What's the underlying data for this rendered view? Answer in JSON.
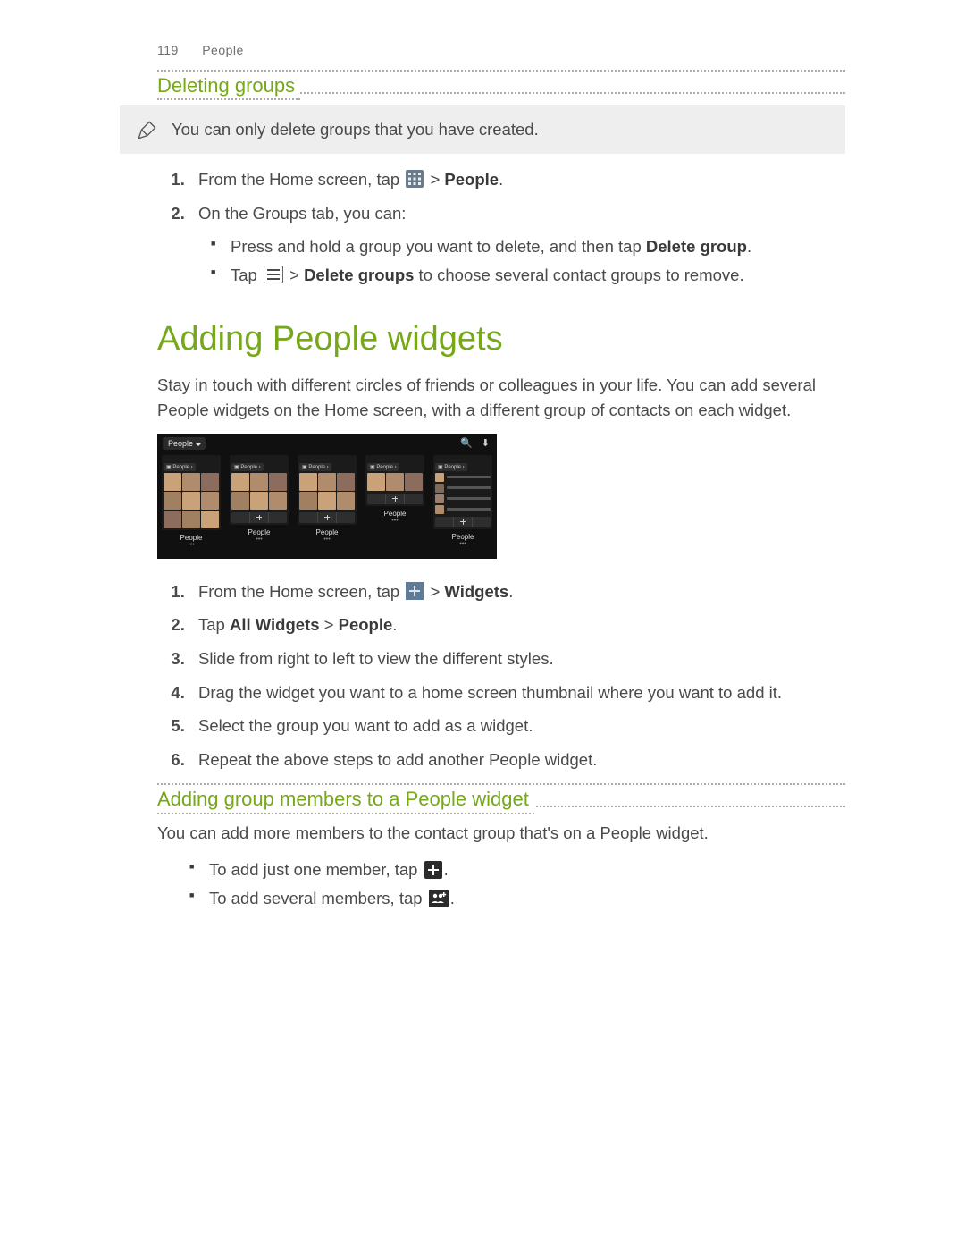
{
  "header": {
    "page_number": "119",
    "section": "People"
  },
  "deleting_groups": {
    "title": "Deleting groups",
    "note": "You can only delete groups that you have created.",
    "step1_a": "From the Home screen, tap ",
    "step1_b": " > ",
    "step1_people": "People",
    "step1_c": ".",
    "step2": "On the Groups tab, you can:",
    "bullet1_a": "Press and hold a group you want to delete, and then tap ",
    "bullet1_b": "Delete group",
    "bullet1_c": ".",
    "bullet2_a": "Tap ",
    "bullet2_b": " > ",
    "bullet2_c": "Delete groups",
    "bullet2_d": " to choose several contact groups to remove."
  },
  "adding_widgets": {
    "title": "Adding People widgets",
    "intro": "Stay in touch with different circles of friends or colleagues in your life. You can add several People widgets on the Home screen, with a different group of contacts on each widget.",
    "figure": {
      "selector_label": "People",
      "widget_label": "People",
      "tabs": [
        "People"
      ]
    },
    "steps": {
      "s1_a": "From the Home screen, tap ",
      "s1_b": " > ",
      "s1_widgets": "Widgets",
      "s1_c": ".",
      "s2_a": "Tap ",
      "s2_b": "All Widgets",
      "s2_c": " > ",
      "s2_d": "People",
      "s2_e": ".",
      "s3": "Slide from right to left to view the different styles.",
      "s4": "Drag the widget you want to a home screen thumbnail where you want to add it.",
      "s5": "Select the group you want to add as a widget.",
      "s6": "Repeat the above steps to add another People widget."
    }
  },
  "adding_members": {
    "title": "Adding group members to a People widget",
    "intro": "You can add more members to the contact group that's on a People widget.",
    "b1_a": "To add just one member, tap ",
    "b1_b": ".",
    "b2_a": "To add several members, tap ",
    "b2_b": "."
  },
  "colors": {
    "accent": "#76a81a",
    "text": "#4a4a4a",
    "note_bg": "#eeeeee",
    "faces": [
      "#caa27a",
      "#7e6a5a",
      "#9a7e6e",
      "#b08c6c",
      "#5c4a3e",
      "#d0b090",
      "#8c6c5c",
      "#c4a080",
      "#4a3a30",
      "#a08060",
      "#6e5a4c",
      "#dcc0a0"
    ]
  }
}
